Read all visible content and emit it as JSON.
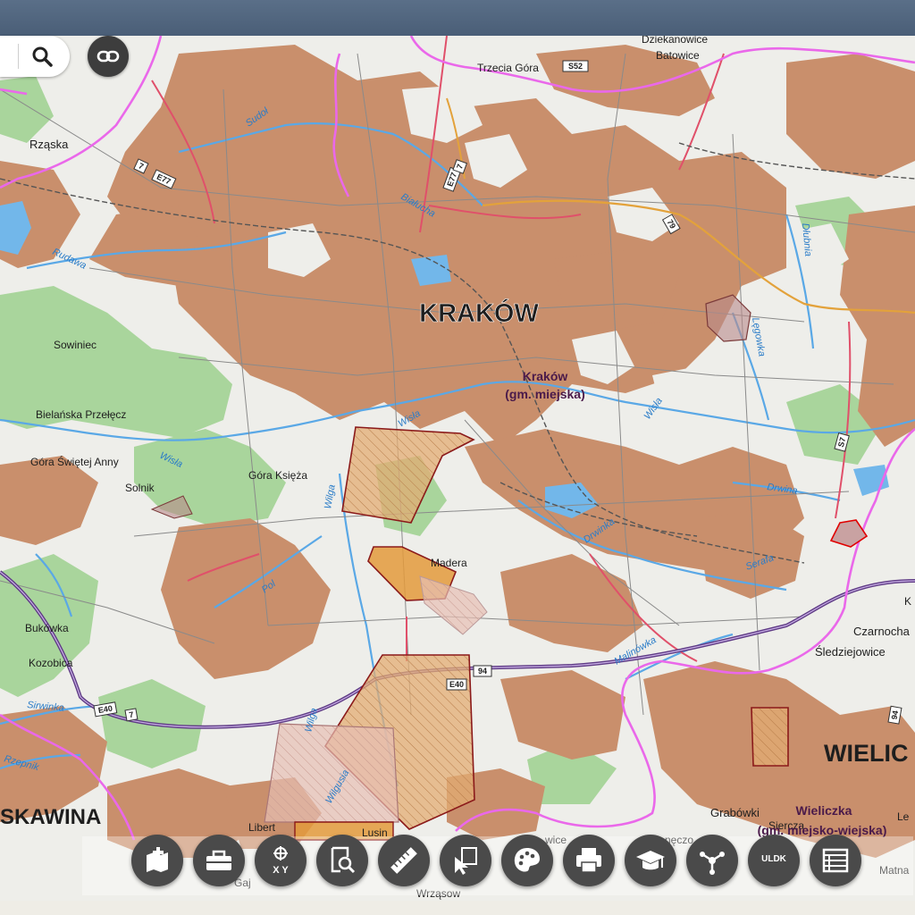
{
  "colors": {
    "urban": "#c98f6c",
    "open": "#eeeeea",
    "forest": "#a9d59c",
    "water": "#72b7ea",
    "boundary": "#ea68ea",
    "road_main": "#e0506a",
    "motorway": "#5f3b85",
    "poly": "#e2ac73"
  },
  "map": {
    "city_label": "KRAKÓW",
    "city_label_2": "WIELIC",
    "city_label_3": "SKAWINA",
    "gmina_krakow_1": "Kraków",
    "gmina_krakow_2": "(gm. miejska)",
    "gmina_wieliczka_1": "Wieliczka",
    "gmina_wieliczka_2": "(gm. miejsko-wiejska)",
    "places": {
      "trzecia": "Trzecia Góra",
      "dziekan": "Dziekanowice",
      "batowice": "Batowice",
      "rzaska": "Rząska",
      "sowiniec": "Sowiniec",
      "bielanska": "Bielańska Przełęcz",
      "gora_anny": "Góra Świętej Anny",
      "solnik": "Solnik",
      "gora_ksieza": "Góra Księża",
      "bukowka": "Bukówka",
      "kozobica": "Kozobica",
      "madera": "Madera",
      "czarnocha": "Czarnocha",
      "sledziejowice": "Śledziejowice",
      "grabowki": "Grabówki",
      "libert": "Libert",
      "lusin": "Lusin",
      "gaj": "Gaj",
      "wrzasow": "Wrząsow",
      "wice": "wice",
      "neczo": "nęczo",
      "siercza": "Siercza",
      "lev": "Le",
      "kk": "K",
      "matna": "Matna"
    },
    "rivers": {
      "sudol": "Sudoł",
      "bialucha": "Białucha",
      "rudawa": "Rudawa",
      "wisla1": "Wisła",
      "wisla2": "Wisła",
      "wisla3": "Wisła",
      "wilga1": "Wilga",
      "wilga2": "Wilga",
      "pollywka": "Pol",
      "drwinka": "Drwinka",
      "drwina": "Drwina",
      "serafa": "Serafa",
      "malinowka": "Malinówka",
      "sirwinka": "Sirwinka",
      "rzepnik": "Rzepnik",
      "dlubnia": "Dłubnia",
      "lepowka": "Lęgowka",
      "wilgusia": "Wilgusia"
    },
    "roads": {
      "s52": "S52",
      "e77": "E77",
      "r7a": "7",
      "r7b": "7",
      "r7c": "7",
      "e77b": "E77",
      "r79": "79",
      "r94": "94",
      "e40": "E40",
      "e40b": "E40",
      "s7": "S7",
      "r94b": "94"
    }
  },
  "search": {
    "icon": "search-icon"
  },
  "link_button": {
    "icon": "link-icon"
  },
  "toolbar": {
    "items": [
      {
        "name": "add-map-button",
        "icon": "map-add-icon"
      },
      {
        "name": "toolbox-button",
        "icon": "toolbox-icon"
      },
      {
        "name": "coordinates-button",
        "icon": "xy-crosshair-icon",
        "label": "X Y"
      },
      {
        "name": "search-parcel-button",
        "icon": "document-search-icon"
      },
      {
        "name": "measure-button",
        "icon": "ruler-icon"
      },
      {
        "name": "select-button",
        "icon": "cursor-select-icon"
      },
      {
        "name": "palette-button",
        "icon": "palette-icon"
      },
      {
        "name": "print-button",
        "icon": "printer-icon"
      },
      {
        "name": "education-button",
        "icon": "graduation-cap-icon"
      },
      {
        "name": "share-button",
        "icon": "share-icon"
      },
      {
        "name": "uldk-button",
        "icon": "uldk-icon",
        "label": "ULDK"
      },
      {
        "name": "list-button",
        "icon": "list-icon"
      }
    ]
  }
}
